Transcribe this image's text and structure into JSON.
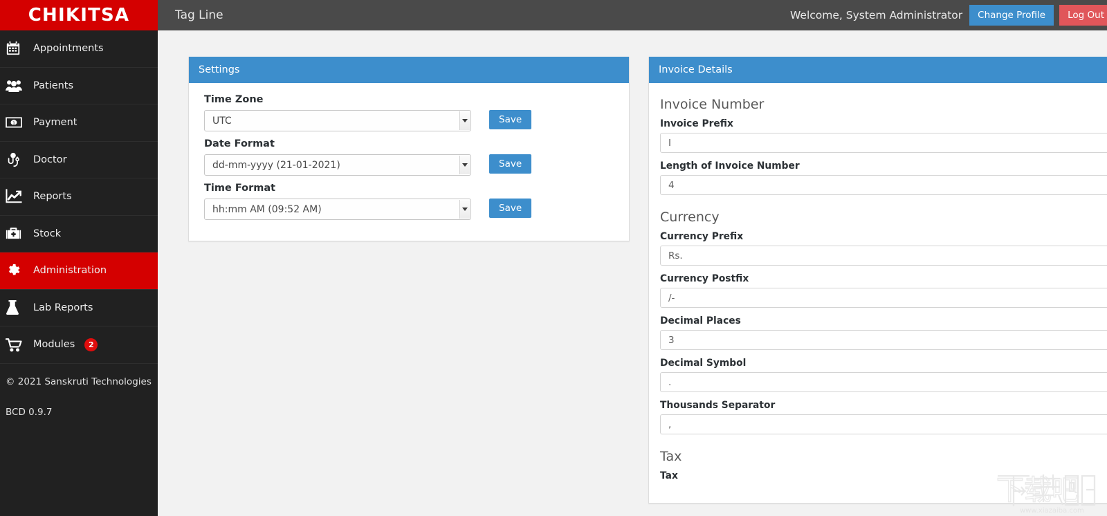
{
  "brand": {
    "name": "CHIKITSA"
  },
  "topbar": {
    "tagline": "Tag Line",
    "welcome": "Welcome, System Administrator",
    "change_profile_label": "Change Profile",
    "logout_label": "Log Out"
  },
  "sidebar": {
    "items": [
      {
        "label": "Appointments",
        "icon": "calendar-icon",
        "active": false,
        "badge": null
      },
      {
        "label": "Patients",
        "icon": "users-icon",
        "active": false,
        "badge": null
      },
      {
        "label": "Payment",
        "icon": "money-bill-icon",
        "active": false,
        "badge": null
      },
      {
        "label": "Doctor",
        "icon": "doctor-icon",
        "active": false,
        "badge": null
      },
      {
        "label": "Reports",
        "icon": "chart-line-icon",
        "active": false,
        "badge": null
      },
      {
        "label": "Stock",
        "icon": "medkit-icon",
        "active": false,
        "badge": null
      },
      {
        "label": "Administration",
        "icon": "gear-icon",
        "active": true,
        "badge": null
      },
      {
        "label": "Lab Reports",
        "icon": "flask-icon",
        "active": false,
        "badge": null
      },
      {
        "label": "Modules",
        "icon": "cart-icon",
        "active": false,
        "badge": "2"
      }
    ],
    "copyright": "© 2021 Sanskruti Technologies",
    "version": "BCD 0.9.7"
  },
  "settings_panel": {
    "title": "Settings",
    "fields": [
      {
        "label": "Time Zone",
        "value": "UTC",
        "save_label": "Save"
      },
      {
        "label": "Date Format",
        "value": "dd-mm-yyyy (21-01-2021)",
        "save_label": "Save"
      },
      {
        "label": "Time Format",
        "value": "hh:mm AM (09:52 AM)",
        "save_label": "Save"
      }
    ]
  },
  "invoice_panel": {
    "title": "Invoice Details",
    "sections": [
      {
        "heading": "Invoice Number",
        "fields": [
          {
            "label": "Invoice Prefix",
            "value": "I"
          },
          {
            "label": "Length of Invoice Number",
            "value": "4"
          }
        ]
      },
      {
        "heading": "Currency",
        "fields": [
          {
            "label": "Currency Prefix",
            "value": "Rs."
          },
          {
            "label": "Currency Postfix",
            "value": "/-"
          },
          {
            "label": "Decimal Places",
            "value": "3"
          },
          {
            "label": "Decimal Symbol",
            "value": "."
          },
          {
            "label": "Thousands Separator",
            "value": ","
          }
        ]
      },
      {
        "heading": "Tax",
        "fields": [
          {
            "label": "Tax",
            "value": ""
          }
        ]
      }
    ]
  },
  "watermark": {
    "cjk": "下载吧",
    "url": "www.xiazaiba.com"
  },
  "colors": {
    "brand_red": "#d40000",
    "sidebar_bg": "#212121",
    "topbar_bg": "#4a4a4a",
    "accent_blue": "#3d8ecc",
    "logout_red": "#e0565a",
    "content_bg": "#f2f2f2"
  }
}
